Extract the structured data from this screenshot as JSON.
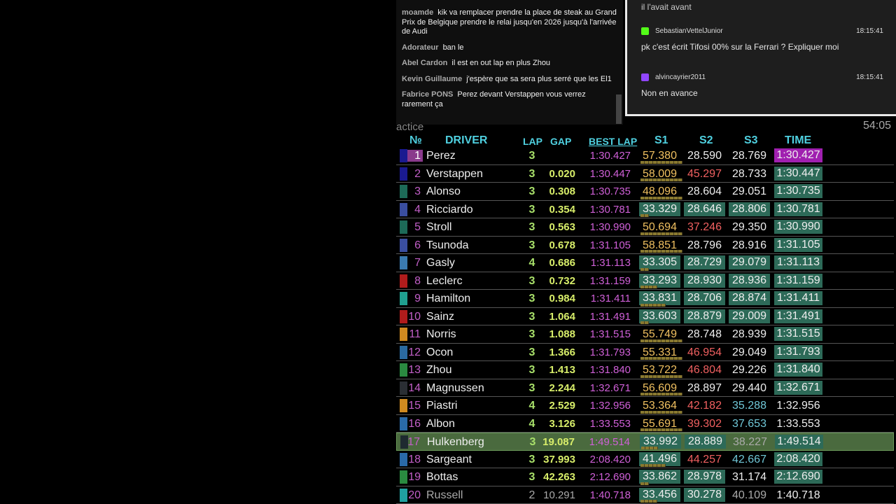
{
  "chat": [
    {
      "author": "moamde",
      "text": "kik va remplacer prendre la place de steak au Grand Prix de Belgique prendre le relai jusqu'en 2026 jusqu'à l'arrivée de Audi"
    },
    {
      "author": "Adorateur",
      "text": "ban le"
    },
    {
      "author": "Abel Cardon",
      "text": "il est en out lap en plus Zhou"
    },
    {
      "author": "Kevin Guillaume",
      "text": "j'espère que sa sera plus serré que les El1"
    },
    {
      "author": "Fabrice PONS",
      "text": "Perez devant Verstappen vous verrez rarement ça"
    }
  ],
  "session_label": "actice",
  "panel2": {
    "partial_msg": "il l'avait avant",
    "messages": [
      {
        "platform": "kick-icon",
        "color": "#53fc18",
        "user": "SebastianVettelJunior",
        "time": "18:15:41",
        "text": "pk c'est écrit Tifosi 00% sur la Ferrari ? Expliquer moi"
      },
      {
        "platform": "twitch-icon",
        "color": "#9146ff",
        "user": "alvincayrier2011",
        "time": "18:15:41",
        "text": "Non en avance"
      }
    ]
  },
  "clock": "54:05",
  "headers": {
    "pos": "№",
    "driver": "DRIVER",
    "lap": "LAP",
    "gap": "GAP",
    "best": "BEST LAP",
    "s1": "S1",
    "s2": "S2",
    "s3": "S3",
    "time": "TIME"
  },
  "rows": [
    {
      "pos": "1",
      "driver": "Perez",
      "team": "#1a1a90",
      "lap": "3",
      "gap": "",
      "best": "1:30.427",
      "s1": "57.380",
      "s2": "28.590",
      "s3": "28.769",
      "time": "1:30.427",
      "st": [
        "y",
        "w",
        "w",
        "p"
      ]
    },
    {
      "pos": "2",
      "driver": "Verstappen",
      "team": "#1a1a90",
      "lap": "3",
      "gap": "0.020",
      "best": "1:30.447",
      "s1": "58.009",
      "s2": "45.297",
      "s3": "28.733",
      "time": "1:30.447",
      "st": [
        "y",
        "r",
        "w",
        "g"
      ]
    },
    {
      "pos": "3",
      "driver": "Alonso",
      "team": "#1d6a58",
      "lap": "3",
      "gap": "0.308",
      "best": "1:30.735",
      "s1": "48.096",
      "s2": "28.604",
      "s3": "29.051",
      "time": "1:30.735",
      "st": [
        "y",
        "w",
        "w",
        "g"
      ]
    },
    {
      "pos": "4",
      "driver": "Ricciardo",
      "team": "#3a4ea0",
      "lap": "3",
      "gap": "0.354",
      "best": "1:30.781",
      "s1": "33.329",
      "s2": "28.646",
      "s3": "28.806",
      "time": "1:30.781",
      "st": [
        "g",
        "g",
        "g",
        "g"
      ]
    },
    {
      "pos": "5",
      "driver": "Stroll",
      "team": "#1d6a58",
      "lap": "3",
      "gap": "0.563",
      "best": "1:30.990",
      "s1": "50.694",
      "s2": "37.246",
      "s3": "29.350",
      "time": "1:30.990",
      "st": [
        "y",
        "r",
        "w",
        "g"
      ]
    },
    {
      "pos": "6",
      "driver": "Tsunoda",
      "team": "#3a4ea0",
      "lap": "3",
      "gap": "0.678",
      "best": "1:31.105",
      "s1": "58.851",
      "s2": "28.796",
      "s3": "28.916",
      "time": "1:31.105",
      "st": [
        "y",
        "w",
        "w",
        "g"
      ]
    },
    {
      "pos": "7",
      "driver": "Gasly",
      "team": "#3a7ab0",
      "lap": "4",
      "gap": "0.686",
      "best": "1:31.113",
      "s1": "33.305",
      "s2": "28.729",
      "s3": "29.079",
      "time": "1:31.113",
      "st": [
        "g",
        "g",
        "g",
        "g"
      ]
    },
    {
      "pos": "8",
      "driver": "Leclerc",
      "team": "#b01c1c",
      "lap": "3",
      "gap": "0.732",
      "best": "1:31.159",
      "s1": "33.293",
      "s2": "28.930",
      "s3": "28.936",
      "time": "1:31.159",
      "st": [
        "g",
        "g",
        "g",
        "g"
      ]
    },
    {
      "pos": "9",
      "driver": "Hamilton",
      "team": "#20a090",
      "lap": "3",
      "gap": "0.984",
      "best": "1:31.411",
      "s1": "33.831",
      "s2": "28.706",
      "s3": "28.874",
      "time": "1:31.411",
      "st": [
        "g",
        "g",
        "g",
        "g"
      ]
    },
    {
      "pos": "10",
      "driver": "Sainz",
      "team": "#b01c1c",
      "lap": "3",
      "gap": "1.064",
      "best": "1:31.491",
      "s1": "33.603",
      "s2": "28.879",
      "s3": "29.009",
      "time": "1:31.491",
      "st": [
        "g",
        "g",
        "g",
        "g"
      ]
    },
    {
      "pos": "11",
      "driver": "Norris",
      "team": "#d08a20",
      "lap": "3",
      "gap": "1.088",
      "best": "1:31.515",
      "s1": "55.749",
      "s2": "28.748",
      "s3": "28.939",
      "time": "1:31.515",
      "st": [
        "y",
        "w",
        "w",
        "g"
      ]
    },
    {
      "pos": "12",
      "driver": "Ocon",
      "team": "#2a6aa0",
      "lap": "3",
      "gap": "1.366",
      "best": "1:31.793",
      "s1": "55.331",
      "s2": "46.954",
      "s3": "29.049",
      "time": "1:31.793",
      "st": [
        "y",
        "r",
        "w",
        "g"
      ]
    },
    {
      "pos": "13",
      "driver": "Zhou",
      "team": "#2a8a40",
      "lap": "3",
      "gap": "1.413",
      "best": "1:31.840",
      "s1": "53.722",
      "s2": "46.804",
      "s3": "29.226",
      "time": "1:31.840",
      "st": [
        "y",
        "r",
        "w",
        "g"
      ]
    },
    {
      "pos": "14",
      "driver": "Magnussen",
      "team": "#2a2e34",
      "lap": "3",
      "gap": "2.244",
      "best": "1:32.671",
      "s1": "56.609",
      "s2": "28.897",
      "s3": "29.440",
      "time": "1:32.671",
      "st": [
        "y",
        "w",
        "w",
        "g"
      ]
    },
    {
      "pos": "15",
      "driver": "Piastri",
      "team": "#d08a20",
      "lap": "4",
      "gap": "2.529",
      "best": "1:32.956",
      "s1": "53.364",
      "s2": "42.182",
      "s3": "35.288",
      "time": "1:32.956",
      "st": [
        "y",
        "r",
        "c",
        "w"
      ]
    },
    {
      "pos": "16",
      "driver": "Albon",
      "team": "#2a6aa8",
      "lap": "4",
      "gap": "3.126",
      "best": "1:33.553",
      "s1": "55.691",
      "s2": "39.302",
      "s3": "37.653",
      "time": "1:33.553",
      "st": [
        "y",
        "r",
        "c",
        "w"
      ]
    },
    {
      "pos": "17",
      "driver": "Hulkenberg",
      "team": "#1e2a30",
      "lap": "3",
      "gap": "19.087",
      "best": "1:49.514",
      "s1": "33.992",
      "s2": "28.889",
      "s3": "38.227",
      "time": "1:49.514",
      "st": [
        "g",
        "g",
        "d",
        "g"
      ],
      "highlight": true
    },
    {
      "pos": "18",
      "driver": "Sargeant",
      "team": "#2a6aa8",
      "lap": "3",
      "gap": "37.993",
      "best": "2:08.420",
      "s1": "41.496",
      "s2": "44.257",
      "s3": "42.667",
      "time": "2:08.420",
      "st": [
        "g",
        "r",
        "c",
        "g"
      ]
    },
    {
      "pos": "19",
      "driver": "Bottas",
      "team": "#2a8a40",
      "lap": "3",
      "gap": "42.263",
      "best": "2:12.690",
      "s1": "33.862",
      "s2": "28.978",
      "s3": "31.174",
      "time": "2:12.690",
      "st": [
        "g",
        "g",
        "w",
        "g"
      ]
    },
    {
      "pos": "20",
      "driver": "Russell",
      "team": "#20a0a0",
      "lap": "2",
      "gap": "10.291",
      "best": "1:40.718",
      "s1": "33.456",
      "s2": "30.278",
      "s3": "40.109",
      "time": "1:40.718",
      "st": [
        "g",
        "g",
        "d",
        "w"
      ],
      "dim": true
    }
  ]
}
